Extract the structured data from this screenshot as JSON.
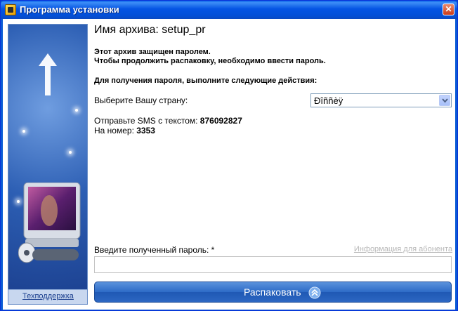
{
  "window": {
    "title": "Программа установки",
    "close_glyph": "✕"
  },
  "sidebar": {
    "support_link": "Техподдержка",
    "icons": [
      "up-arrow-graphic",
      "media-player-device-graphic"
    ]
  },
  "main": {
    "archive_title": "Имя архива: setup_pr",
    "protected_line1": "Этот архив защищен паролем.",
    "protected_line2": "Чтобы продолжить распаковку, необходимо ввести пароль.",
    "instructions": "Для получения пароля, выполните следующие действия:",
    "country_label": "Выберите Вашу страну:",
    "country_value": "Ðîññèÿ",
    "sms_text_label": "Отправьте SMS с текстом:",
    "sms_text_value": "876092827",
    "number_label": "На номер:",
    "number_value": "3353",
    "password_label": "Введите полученный пароль: *",
    "subscriber_info_link": "Информация для абонента",
    "password_value": "",
    "unpack_button": "Распаковать"
  },
  "colors": {
    "titlebar": "#0554e3",
    "button": "#2d6bc7",
    "sidebar": "#2d5fb4"
  }
}
